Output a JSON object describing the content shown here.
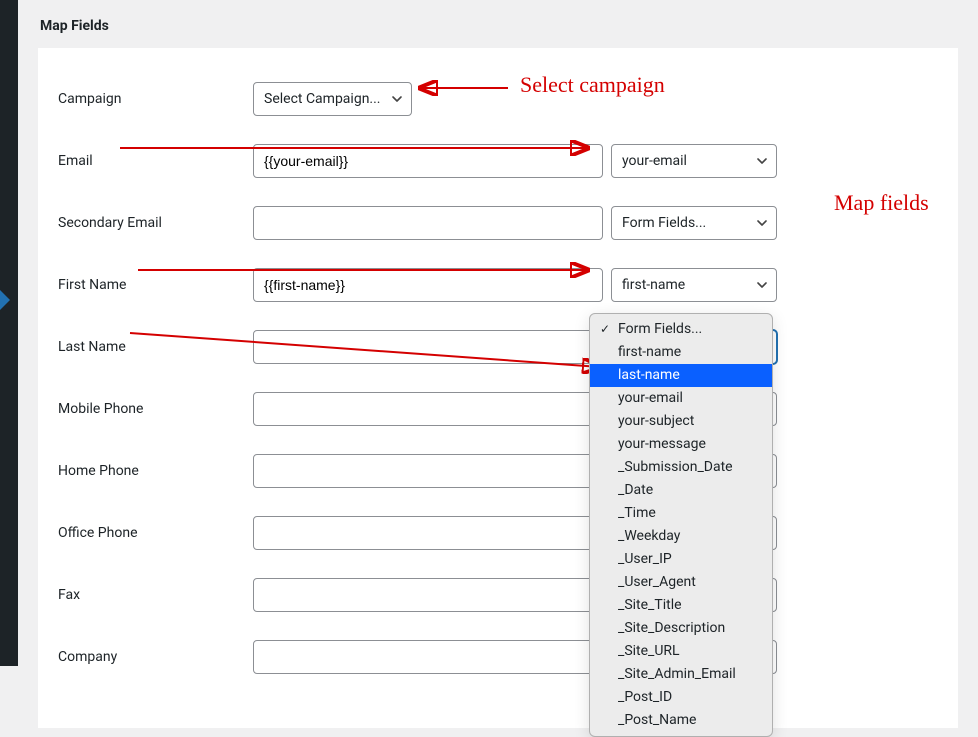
{
  "sectionTitle": "Map Fields",
  "annotations": {
    "selectCampaign": "Select campaign",
    "mapFields": "Map fields"
  },
  "rows": {
    "campaign": {
      "label": "Campaign",
      "selectText": "Select Campaign..."
    },
    "email": {
      "label": "Email",
      "value": "{{your-email}}",
      "selectText": "your-email"
    },
    "secondaryEmail": {
      "label": "Secondary Email",
      "value": "",
      "selectText": "Form Fields..."
    },
    "firstName": {
      "label": "First Name",
      "value": "{{first-name}}",
      "selectText": "first-name"
    },
    "lastName": {
      "label": "Last Name",
      "value": "",
      "selectText": "Form Fields..."
    },
    "mobilePhone": {
      "label": "Mobile Phone",
      "value": ""
    },
    "homePhone": {
      "label": "Home Phone",
      "value": ""
    },
    "officePhone": {
      "label": "Office Phone",
      "value": ""
    },
    "fax": {
      "label": "Fax",
      "value": ""
    },
    "company": {
      "label": "Company",
      "value": ""
    }
  },
  "dropdown": {
    "items": [
      {
        "label": "Form Fields...",
        "checked": true
      },
      {
        "label": "first-name"
      },
      {
        "label": "last-name",
        "highlight": true
      },
      {
        "label": "your-email"
      },
      {
        "label": "your-subject"
      },
      {
        "label": "your-message"
      },
      {
        "label": "_Submission_Date"
      },
      {
        "label": "_Date"
      },
      {
        "label": "_Time"
      },
      {
        "label": "_Weekday"
      },
      {
        "label": "_User_IP"
      },
      {
        "label": "_User_Agent"
      },
      {
        "label": "_Site_Title"
      },
      {
        "label": "_Site_Description"
      },
      {
        "label": "_Site_URL"
      },
      {
        "label": "_Site_Admin_Email"
      },
      {
        "label": "_Post_ID"
      },
      {
        "label": "_Post_Name"
      }
    ]
  }
}
